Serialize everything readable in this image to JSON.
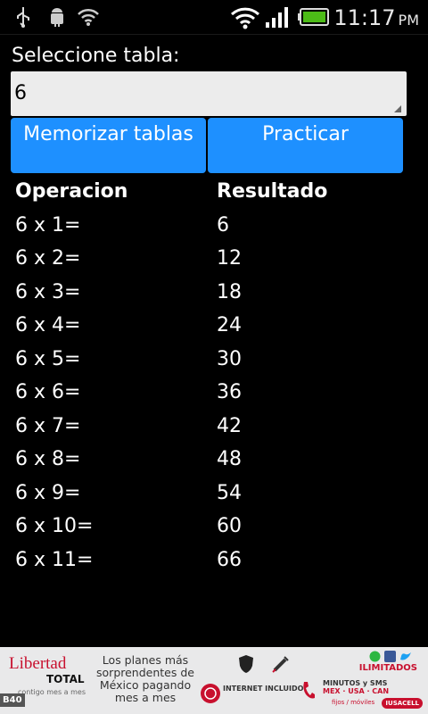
{
  "status_bar": {
    "time": "11:17",
    "ampm": "PM",
    "icons": [
      "usb-icon",
      "android-debug-icon",
      "wifi-icon",
      "wifi-signal-icon",
      "cell-signal-icon",
      "battery-icon"
    ],
    "accent_battery": "#4cbb17"
  },
  "selector": {
    "label": "Seleccione tabla:",
    "value": "6"
  },
  "buttons": {
    "memorize": "Memorizar tablas",
    "practice": "Practicar",
    "color": "#1e90ff"
  },
  "table": {
    "headers": [
      "Operacion",
      "Resultado"
    ],
    "rows": [
      {
        "op": "6 x 1=",
        "res": "6"
      },
      {
        "op": "6 x 2=",
        "res": "12"
      },
      {
        "op": "6 x 3=",
        "res": "18"
      },
      {
        "op": "6 x 4=",
        "res": "24"
      },
      {
        "op": "6 x 5=",
        "res": "30"
      },
      {
        "op": "6 x 6=",
        "res": "36"
      },
      {
        "op": "6 x 7=",
        "res": "42"
      },
      {
        "op": "6 x 8=",
        "res": "48"
      },
      {
        "op": "6 x 9=",
        "res": "54"
      },
      {
        "op": "6 x 10=",
        "res": "60"
      },
      {
        "op": "6 x 11=",
        "res": "66"
      }
    ]
  },
  "ad": {
    "brand": "Libertad",
    "brand_sub": "TOTAL",
    "brand_tag": "contigo mes a mes",
    "promo": "Los planes más sorprendentes de México pagando mes a mes",
    "unlimited": "ILIMITADOS",
    "internet": "INTERNET INCLUIDO",
    "minutes": "MINUTOS y SMS",
    "countries": "MEX · USA · CAN",
    "fixed": "fijos / móviles",
    "carrier": "IUSACELL",
    "badge": "B40"
  }
}
